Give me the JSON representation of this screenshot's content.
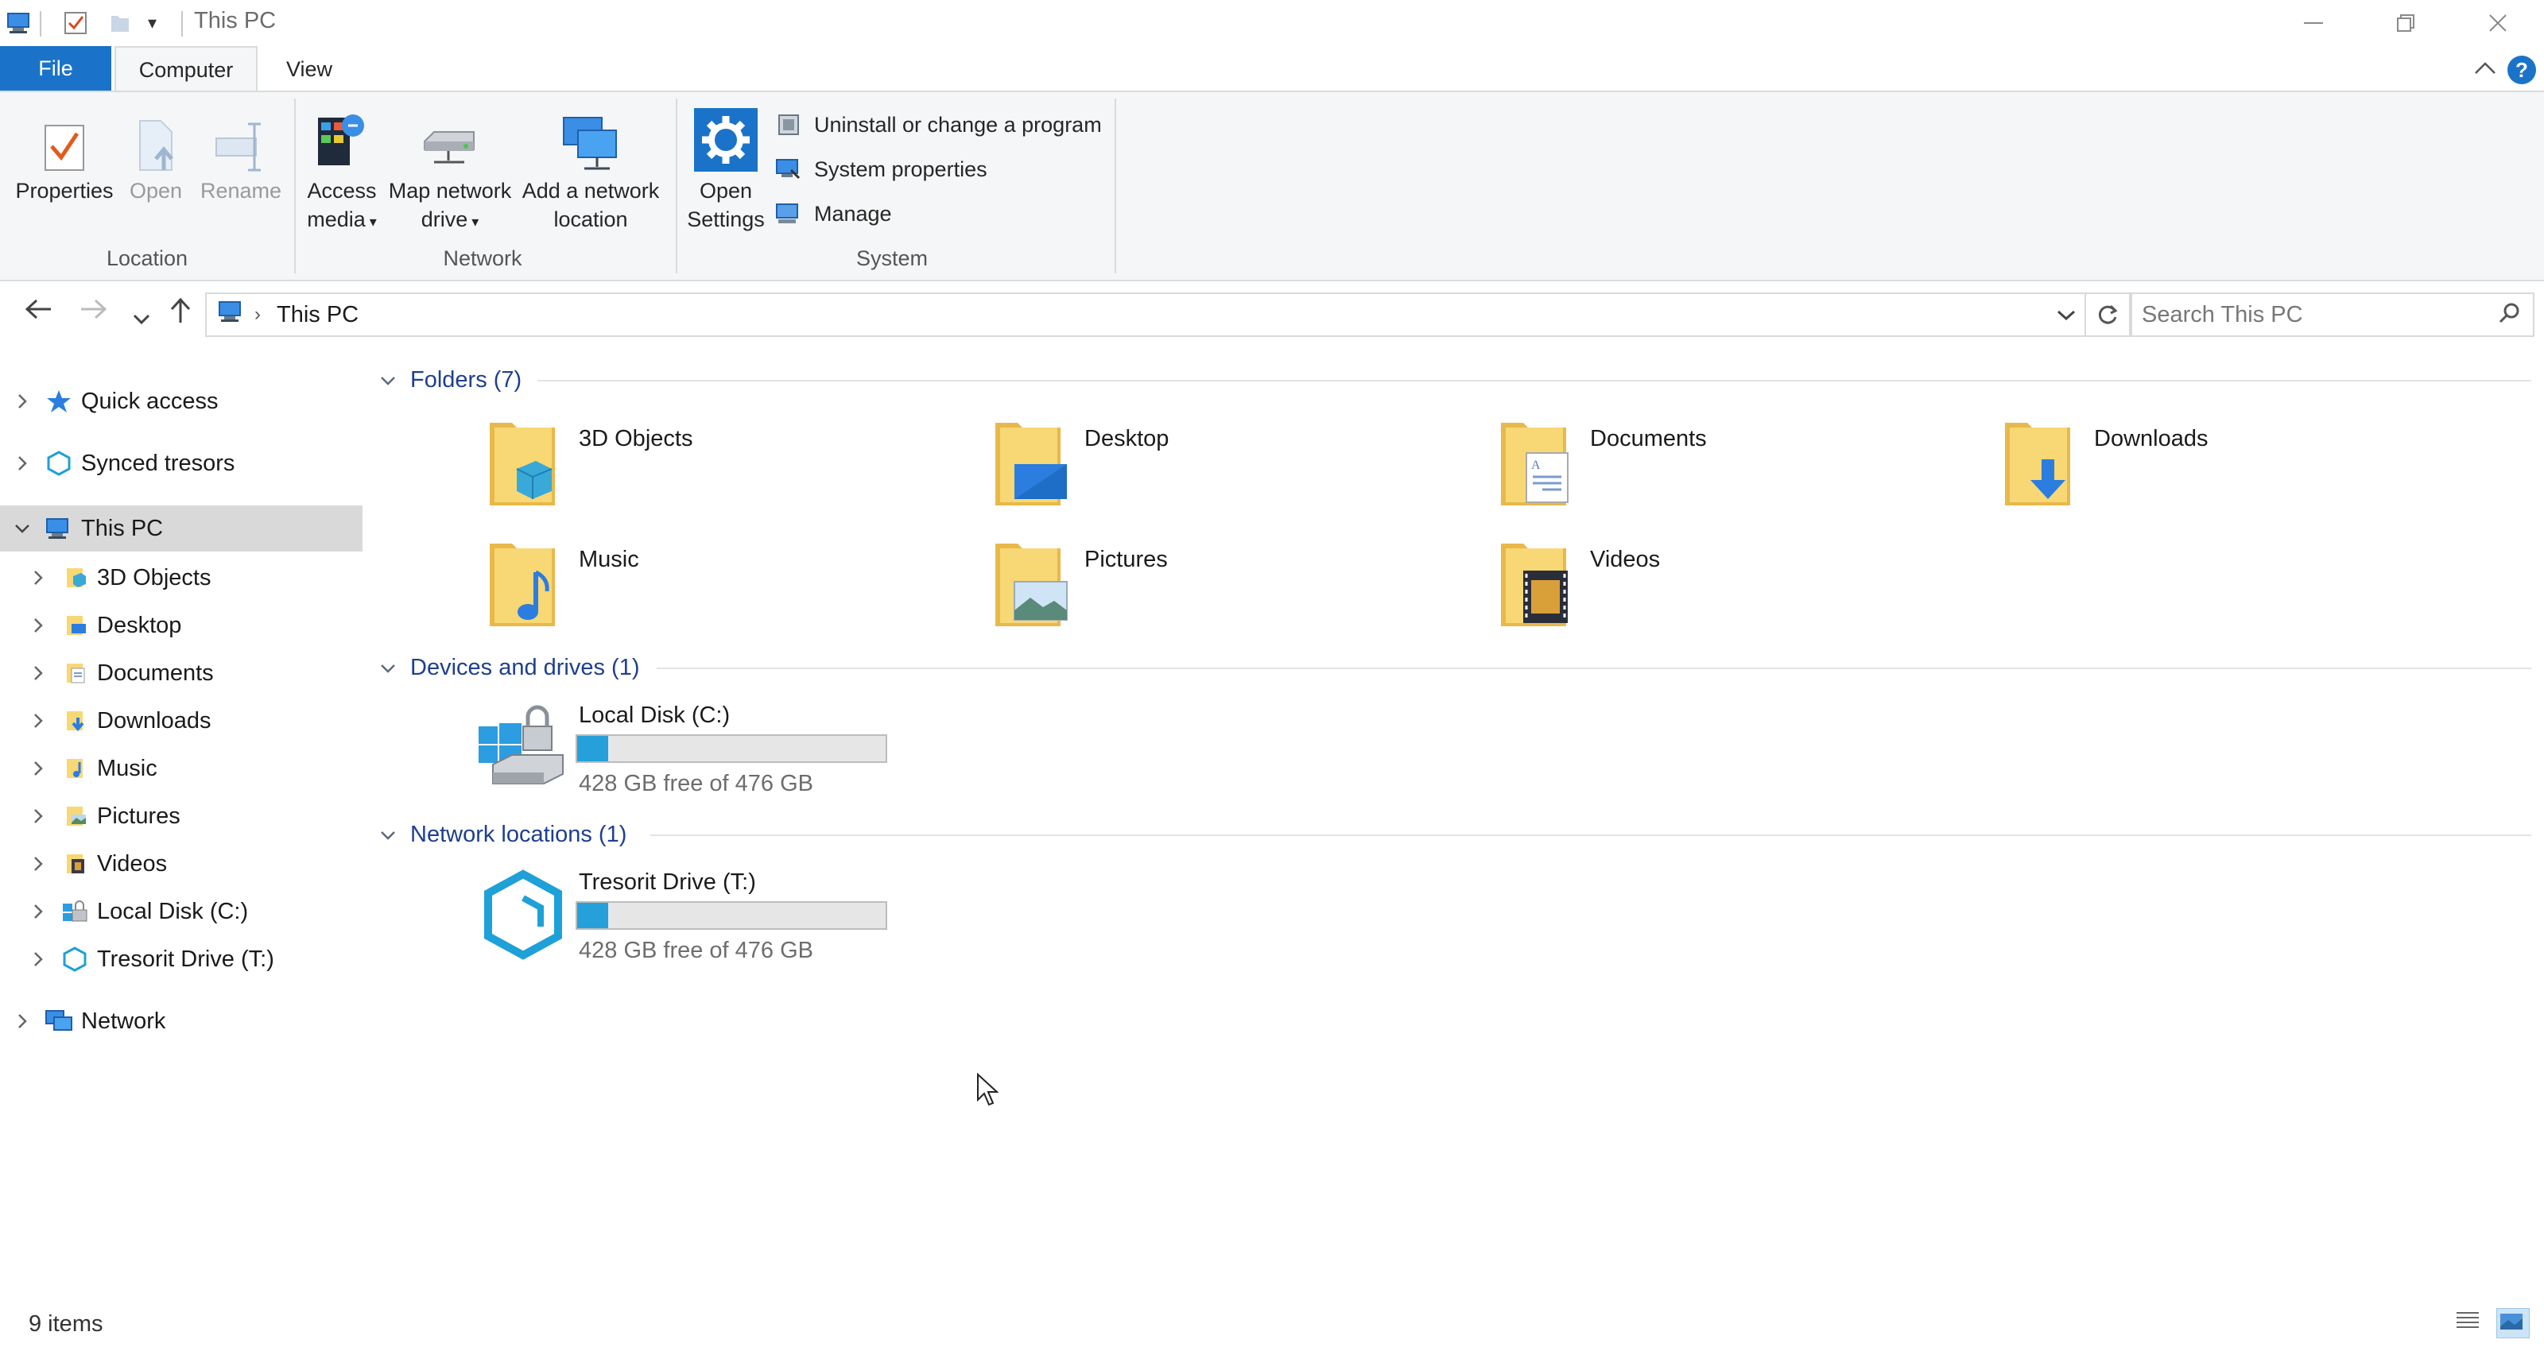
{
  "window": {
    "title": "This PC",
    "minimize_icon": "minimize-icon",
    "restore_icon": "restore-icon",
    "close_icon": "close-icon"
  },
  "ribbon_tabs": {
    "file": "File",
    "computer": "Computer",
    "view": "View",
    "help": "?"
  },
  "ribbon": {
    "location": {
      "label": "Location",
      "properties": "Properties",
      "open": "Open",
      "rename": "Rename"
    },
    "network": {
      "label": "Network",
      "access_media_1": "Access",
      "access_media_2": "media",
      "map_drive_1": "Map network",
      "map_drive_2": "drive",
      "add_location_1": "Add a network",
      "add_location_2": "location"
    },
    "system": {
      "label": "System",
      "open_settings_1": "Open",
      "open_settings_2": "Settings",
      "uninstall": "Uninstall or change a program",
      "system_properties": "System properties",
      "manage": "Manage"
    }
  },
  "address_bar": {
    "path": "This PC",
    "search_placeholder": "Search This PC"
  },
  "nav_pane": {
    "quick_access": "Quick access",
    "synced_tresors": "Synced tresors",
    "this_pc": "This PC",
    "children": [
      "3D Objects",
      "Desktop",
      "Documents",
      "Downloads",
      "Music",
      "Pictures",
      "Videos",
      "Local Disk (C:)",
      "Tresorit Drive (T:)"
    ],
    "network": "Network"
  },
  "content": {
    "folders_header": "Folders (7)",
    "folders": [
      "3D Objects",
      "Desktop",
      "Documents",
      "Downloads",
      "Music",
      "Pictures",
      "Videos"
    ],
    "devices_header": "Devices and drives (1)",
    "local_disk": {
      "name": "Local Disk (C:)",
      "free": "428 GB free of 476 GB",
      "used_fraction": 0.1
    },
    "network_header": "Network locations (1)",
    "tresorit": {
      "name": "Tresorit Drive (T:)",
      "free": "428 GB free of 476 GB",
      "used_fraction": 0.1
    }
  },
  "status": {
    "items": "9 items"
  },
  "colors": {
    "accent": "#1a73c8",
    "drive_fill": "#26a0da",
    "section_header": "#1e3f8f",
    "folder_yellow": "#f8d775"
  }
}
